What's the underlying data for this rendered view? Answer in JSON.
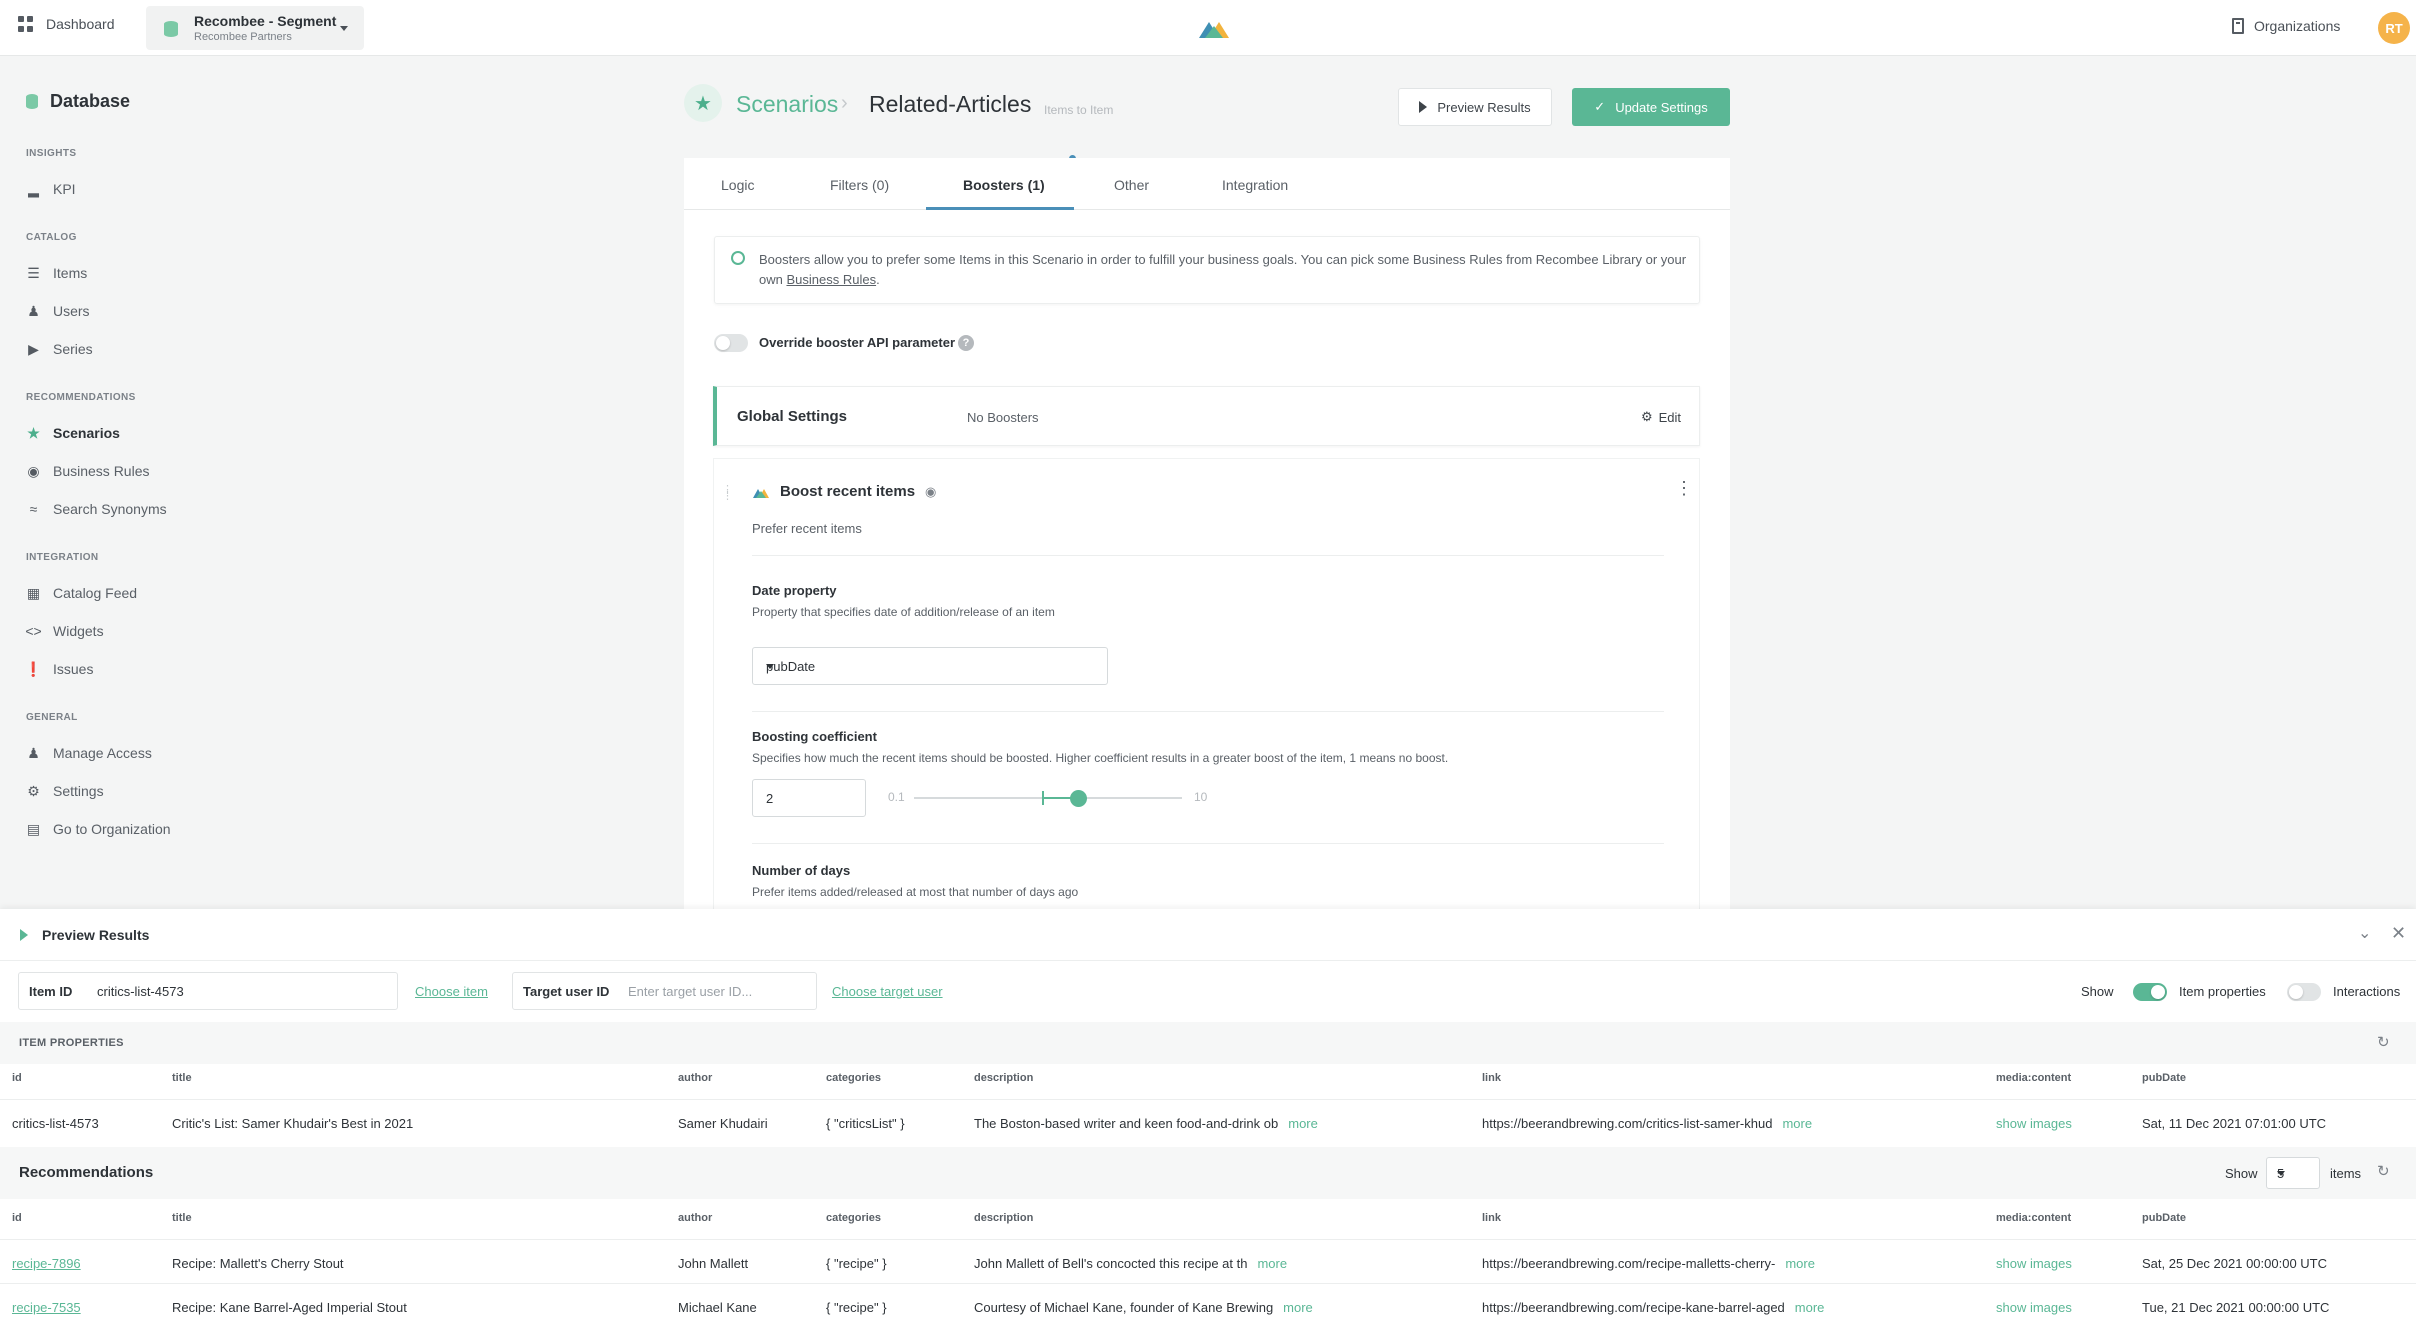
{
  "topbar": {
    "dashboard_label": "Dashboard",
    "db_name": "Recombee - Segment",
    "db_org": "Recombee Partners",
    "organizations_label": "Organizations",
    "avatar_initials": "RT"
  },
  "sidebar": {
    "title": "Database",
    "sections": {
      "insights": "INSIGHTS",
      "catalog": "CATALOG",
      "recommendations": "RECOMMENDATIONS",
      "integration": "INTEGRATION",
      "general": "GENERAL"
    },
    "items": {
      "kpi": "KPI",
      "items": "Items",
      "users": "Users",
      "series": "Series",
      "scenarios": "Scenarios",
      "business_rules": "Business Rules",
      "search_synonyms": "Search Synonyms",
      "catalog_feed": "Catalog Feed",
      "widgets": "Widgets",
      "issues": "Issues",
      "manage_access": "Manage Access",
      "settings": "Settings",
      "go_to_org": "Go to Organization"
    }
  },
  "header": {
    "crumb": "Scenarios",
    "separator": "›",
    "title": "Related-Articles",
    "subtitle": "Items to Item",
    "preview_btn": "Preview Results",
    "update_btn": "Update Settings"
  },
  "tabs": [
    "Logic",
    "Filters (0)",
    "Boosters (1)",
    "Other",
    "Integration"
  ],
  "info": {
    "text": "Boosters allow you to prefer some Items in this Scenario in order to fulfill your business goals. You can pick some Business Rules from Recombee Library or your own ",
    "link": "Business Rules",
    "tail": "."
  },
  "override": {
    "label": "Override booster API parameter",
    "help": "?"
  },
  "global_settings": {
    "title": "Global Settings",
    "value": "No Boosters",
    "edit": "Edit"
  },
  "booster": {
    "title": "Boost recent items",
    "desc": "Prefer recent items",
    "date_label": "Date property",
    "date_desc": "Property that specifies date of addition/release of an item",
    "date_value": "pubDate",
    "coef_label": "Boosting coefficient",
    "coef_desc": "Specifies how much the recent items should be boosted. Higher coefficient results in a greater boost of the item, 1 means no boost.",
    "coef_value": "2",
    "slider_min": "0.1",
    "slider_max": "10",
    "days_label": "Number of days",
    "days_desc": "Prefer items added/released at most that number of days ago"
  },
  "preview": {
    "title": "Preview Results",
    "item_id_label": "Item ID",
    "item_id_value": "critics-list-4573",
    "choose_item": "Choose item",
    "target_label": "Target user ID",
    "target_placeholder": "Enter target user ID...",
    "choose_target": "Choose target user",
    "show_label": "Show",
    "item_props_toggle": "Item properties",
    "interactions_toggle": "Interactions",
    "item_props_heading": "ITEM PROPERTIES",
    "columns": [
      "id",
      "title",
      "author",
      "categories",
      "description",
      "link",
      "media:content",
      "pubDate"
    ],
    "item_row": {
      "id": "critics-list-4573",
      "title": "Critic's List: Samer Khudair's Best in 2021",
      "author": "Samer Khudairi",
      "categories": "{ \"criticsList\" }",
      "description": "The Boston-based writer and keen food-and-drink ob",
      "more": "more",
      "link": "https://beerandbrewing.com/critics-list-samer-khud",
      "media": "show images",
      "pubDate": "Sat, 11 Dec 2021 07:01:00 UTC"
    },
    "recommendations_heading": "Recommendations",
    "rec_show": "Show",
    "rec_count": "5",
    "rec_items": "items",
    "rec_rows": [
      {
        "id": "recipe-7896",
        "title": "Recipe: Mallett's Cherry Stout",
        "author": "John Mallett",
        "categories": "{ \"recipe\" }",
        "description": "John Mallett of Bell's concocted this recipe at th",
        "more": "more",
        "link": "https://beerandbrewing.com/recipe-malletts-cherry-",
        "media": "show images",
        "pubDate": "Sat, 25 Dec 2021 00:00:00 UTC"
      },
      {
        "id": "recipe-7535",
        "title": "Recipe: Kane Barrel-Aged Imperial Stout",
        "author": "Michael Kane",
        "categories": "{ \"recipe\" }",
        "description": "Courtesy of Michael Kane, founder of Kane Brewing",
        "more": "more",
        "link": "https://beerandbrewing.com/recipe-kane-barrel-aged",
        "media": "show images",
        "pubDate": "Tue, 21 Dec 2021 00:00:00 UTC"
      }
    ]
  },
  "colors": {
    "accent": "#5ab795",
    "link_blue": "#4a8fb8",
    "avatar": "#f5b34a"
  }
}
